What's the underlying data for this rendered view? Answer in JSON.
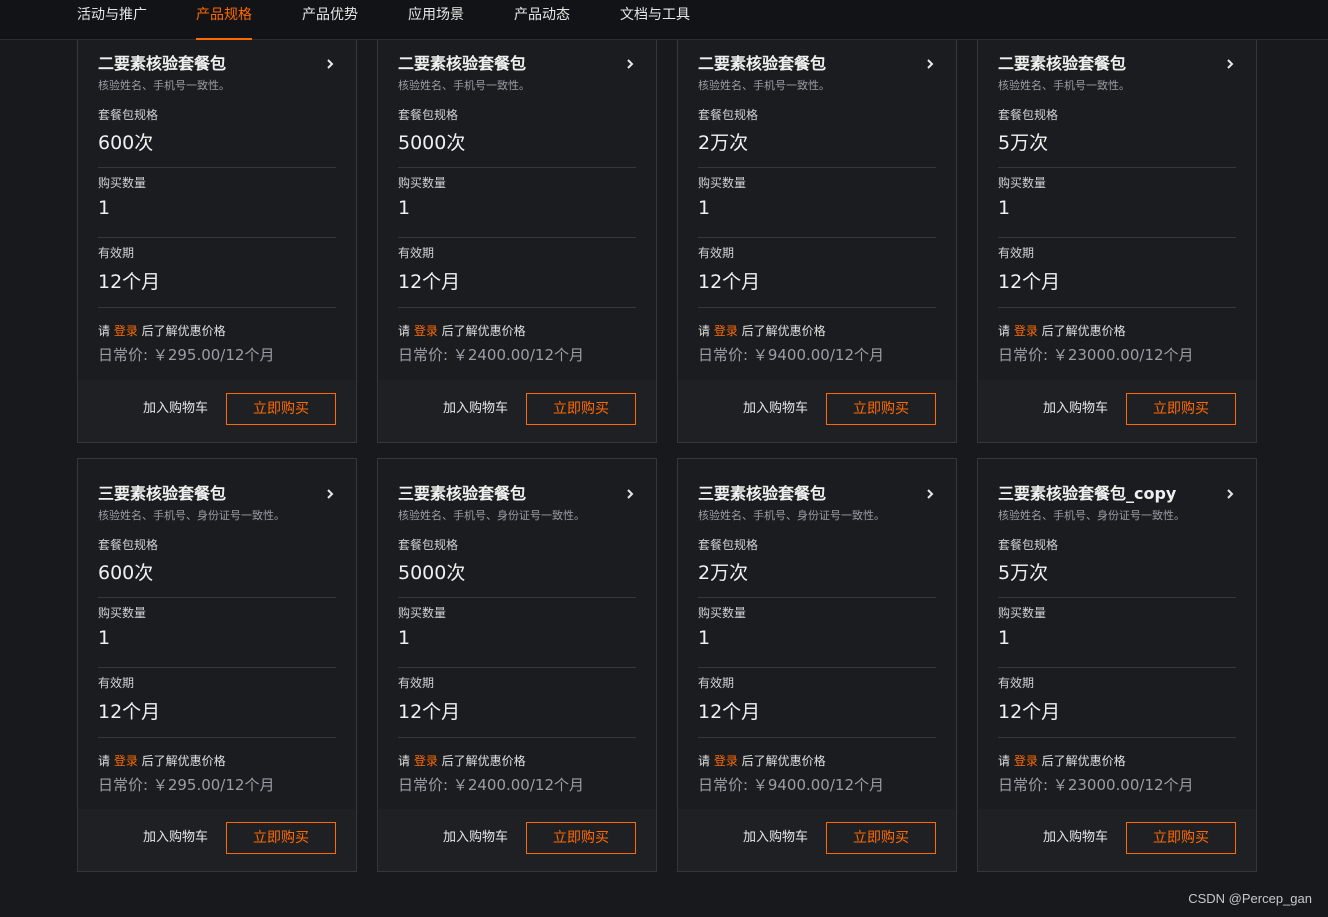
{
  "nav": {
    "items": [
      {
        "label": "活动与推广",
        "active": false
      },
      {
        "label": "产品规格",
        "active": true
      },
      {
        "label": "产品优势",
        "active": false
      },
      {
        "label": "应用场景",
        "active": false
      },
      {
        "label": "产品动态",
        "active": false
      },
      {
        "label": "文档与工具",
        "active": false
      }
    ]
  },
  "labels": {
    "spec": "套餐包规格",
    "quantity": "购买数量",
    "validity": "有效期",
    "login_prefix": "请 ",
    "login_link": "登录",
    "login_suffix": " 后了解优惠价格",
    "add_cart": "加入购物车",
    "buy_now": "立即购买"
  },
  "cards": [
    {
      "title": "二要素核验套餐包",
      "desc": "核验姓名、手机号一致性。",
      "spec": "600次",
      "quantity": "1",
      "validity": "12个月",
      "price": "日常价: ￥295.00/12个月"
    },
    {
      "title": "二要素核验套餐包",
      "desc": "核验姓名、手机号一致性。",
      "spec": "5000次",
      "quantity": "1",
      "validity": "12个月",
      "price": "日常价: ￥2400.00/12个月"
    },
    {
      "title": "二要素核验套餐包",
      "desc": "核验姓名、手机号一致性。",
      "spec": "2万次",
      "quantity": "1",
      "validity": "12个月",
      "price": "日常价: ￥9400.00/12个月"
    },
    {
      "title": "二要素核验套餐包",
      "desc": "核验姓名、手机号一致性。",
      "spec": "5万次",
      "quantity": "1",
      "validity": "12个月",
      "price": "日常价: ￥23000.00/12个月"
    },
    {
      "title": "三要素核验套餐包",
      "desc": "核验姓名、手机号、身份证号一致性。",
      "spec": "600次",
      "quantity": "1",
      "validity": "12个月",
      "price": "日常价: ￥295.00/12个月"
    },
    {
      "title": "三要素核验套餐包",
      "desc": "核验姓名、手机号、身份证号一致性。",
      "spec": "5000次",
      "quantity": "1",
      "validity": "12个月",
      "price": "日常价: ￥2400.00/12个月"
    },
    {
      "title": "三要素核验套餐包",
      "desc": "核验姓名、手机号、身份证号一致性。",
      "spec": "2万次",
      "quantity": "1",
      "validity": "12个月",
      "price": "日常价: ￥9400.00/12个月"
    },
    {
      "title": "三要素核验套餐包_copy",
      "desc": "核验姓名、手机号、身份证号一致性。",
      "spec": "5万次",
      "quantity": "1",
      "validity": "12个月",
      "price": "日常价: ￥23000.00/12个月"
    }
  ],
  "watermark": "CSDN @Percep_gan",
  "colors": {
    "accent": "#ff6a00",
    "background": "#17191c",
    "card_border": "#34373c"
  }
}
